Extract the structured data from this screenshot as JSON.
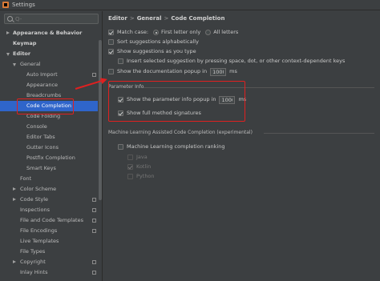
{
  "window": {
    "title": "Settings"
  },
  "search": {
    "placeholder": "Q-"
  },
  "tree": [
    {
      "label": "Appearance & Behavior",
      "bold": true,
      "arrow": "right",
      "indent": 0,
      "icon": false
    },
    {
      "label": "Keymap",
      "bold": true,
      "arrow": "",
      "indent": 0,
      "icon": false
    },
    {
      "label": "Editor",
      "bold": true,
      "arrow": "down",
      "indent": 0,
      "icon": false
    },
    {
      "label": "General",
      "bold": false,
      "arrow": "down",
      "indent": 1,
      "icon": false
    },
    {
      "label": "Auto Import",
      "bold": false,
      "arrow": "",
      "indent": 2,
      "icon": true
    },
    {
      "label": "Appearance",
      "bold": false,
      "arrow": "",
      "indent": 2,
      "icon": false
    },
    {
      "label": "Breadcrumbs",
      "bold": false,
      "arrow": "",
      "indent": 2,
      "icon": false
    },
    {
      "label": "Code Completion",
      "bold": false,
      "arrow": "",
      "indent": 2,
      "icon": false,
      "selected": true
    },
    {
      "label": "Code Folding",
      "bold": false,
      "arrow": "",
      "indent": 2,
      "icon": false
    },
    {
      "label": "Console",
      "bold": false,
      "arrow": "",
      "indent": 2,
      "icon": false
    },
    {
      "label": "Editor Tabs",
      "bold": false,
      "arrow": "",
      "indent": 2,
      "icon": false
    },
    {
      "label": "Gutter Icons",
      "bold": false,
      "arrow": "",
      "indent": 2,
      "icon": false
    },
    {
      "label": "Postfix Completion",
      "bold": false,
      "arrow": "",
      "indent": 2,
      "icon": false
    },
    {
      "label": "Smart Keys",
      "bold": false,
      "arrow": "",
      "indent": 2,
      "icon": false
    },
    {
      "label": "Font",
      "bold": false,
      "arrow": "",
      "indent": 1,
      "icon": false
    },
    {
      "label": "Color Scheme",
      "bold": false,
      "arrow": "right",
      "indent": 1,
      "icon": false
    },
    {
      "label": "Code Style",
      "bold": false,
      "arrow": "right",
      "indent": 1,
      "icon": true
    },
    {
      "label": "Inspections",
      "bold": false,
      "arrow": "",
      "indent": 1,
      "icon": true
    },
    {
      "label": "File and Code Templates",
      "bold": false,
      "arrow": "",
      "indent": 1,
      "icon": true
    },
    {
      "label": "File Encodings",
      "bold": false,
      "arrow": "",
      "indent": 1,
      "icon": true
    },
    {
      "label": "Live Templates",
      "bold": false,
      "arrow": "",
      "indent": 1,
      "icon": false
    },
    {
      "label": "File Types",
      "bold": false,
      "arrow": "",
      "indent": 1,
      "icon": false
    },
    {
      "label": "Copyright",
      "bold": false,
      "arrow": "right",
      "indent": 1,
      "icon": true
    },
    {
      "label": "Inlay Hints",
      "bold": false,
      "arrow": "",
      "indent": 1,
      "icon": true
    }
  ],
  "breadcrumb": {
    "a": "Editor",
    "b": "General",
    "c": "Code Completion",
    "sep": ">"
  },
  "options": {
    "match_case": "Match case:",
    "first_letter": "First letter only",
    "all_letters": "All letters",
    "sort_alpha": "Sort suggestions alphabetically",
    "show_as_you_type": "Show suggestions as you type",
    "insert_selected": "Insert selected suggestion by pressing space, dot, or other context-dependent keys",
    "show_doc_popup": "Show the documentation popup in",
    "doc_popup_value": "1000",
    "ms": "ms"
  },
  "param_info": {
    "title": "Parameter Info",
    "show_popup": "Show the parameter info popup in",
    "popup_value": "1000",
    "ms": "ms",
    "full_sigs": "Show full method signatures"
  },
  "ml": {
    "title": "Machine Learning Assisted Code Completion (experimental)",
    "ranking": "Machine Learning completion ranking",
    "langs": [
      "Java",
      "Kotlin",
      "Python"
    ]
  }
}
